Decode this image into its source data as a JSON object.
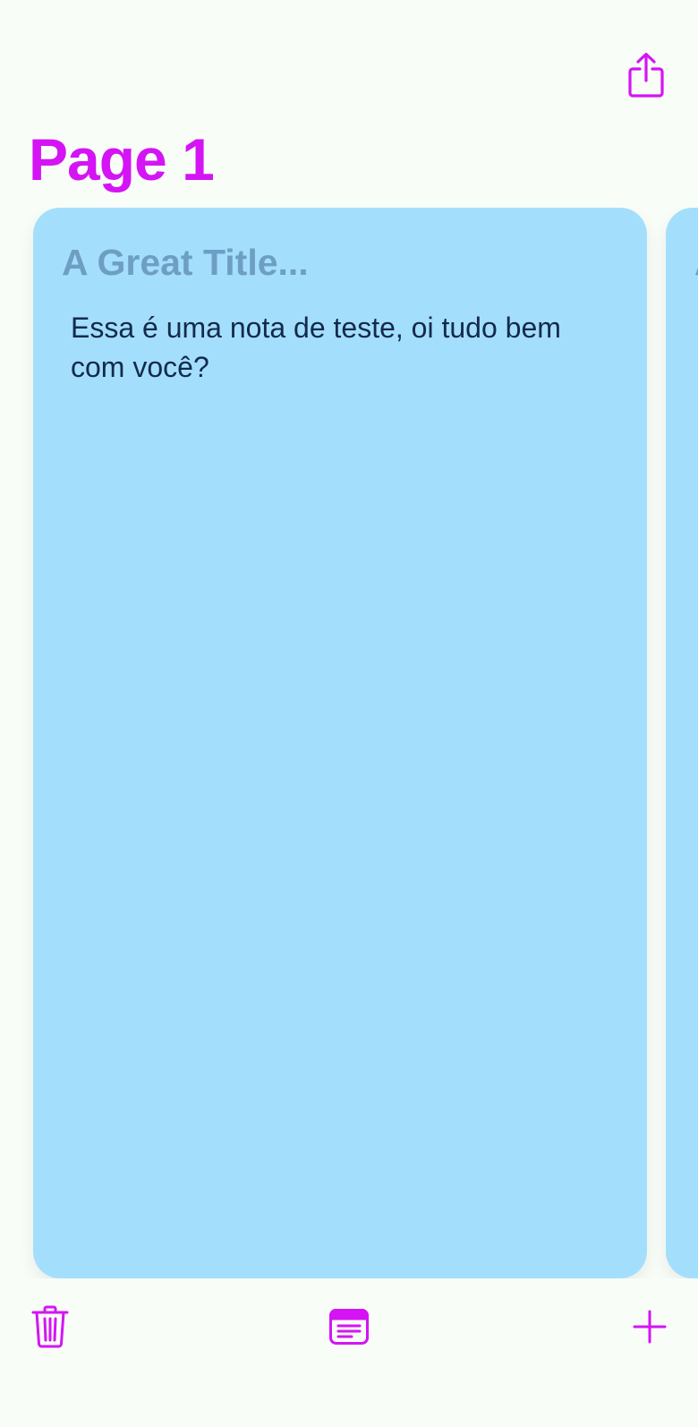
{
  "header": {
    "page_title": "Page 1",
    "share_icon": "share-icon"
  },
  "notes": [
    {
      "title": "A Great Title...",
      "body": "Essa é uma nota de teste, oi tudo bem com você?"
    }
  ],
  "toolbar": {
    "delete_icon": "trash-icon",
    "notes_icon": "note-list-icon",
    "add_icon": "plus-icon"
  },
  "colors": {
    "accent": "#d414f5",
    "background": "#f8fdf7",
    "card": "#a3dffd",
    "card_title": "#6e9ec3",
    "card_text": "#142a4b"
  }
}
